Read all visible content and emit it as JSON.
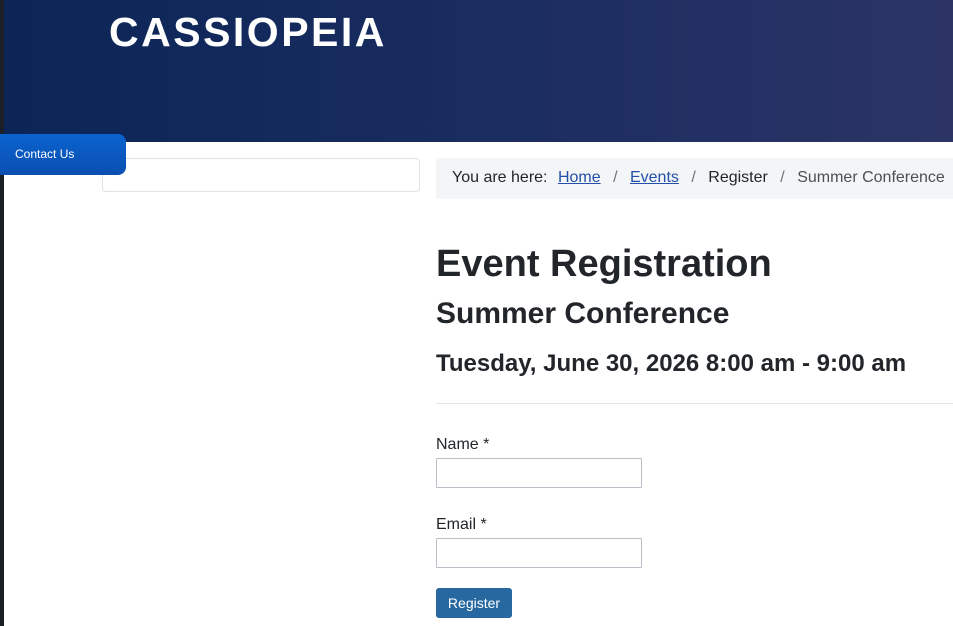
{
  "header": {
    "brand": "CASSIOPEIA"
  },
  "contact_tab": {
    "label": "Contact Us"
  },
  "breadcrumb": {
    "prefix": "You are here:",
    "items": [
      {
        "label": "Home",
        "link": true
      },
      {
        "label": "Events",
        "link": true
      },
      {
        "label": "Register",
        "link": false
      },
      {
        "label": "Summer Conference",
        "link": false
      }
    ],
    "separator": "/"
  },
  "main": {
    "title": "Event Registration",
    "event_name": "Summer Conference",
    "event_datetime": "Tuesday, June 30, 2026 8:00 am - 9:00 am"
  },
  "form": {
    "name_label": "Name *",
    "name_value": "",
    "email_label": "Email *",
    "email_value": "",
    "submit_label": "Register"
  },
  "colors": {
    "header_start": "#0b2556",
    "header_end": "#2c3466",
    "contact_tab": "#0a5bc4",
    "link": "#224faa",
    "button": "#26689f"
  }
}
